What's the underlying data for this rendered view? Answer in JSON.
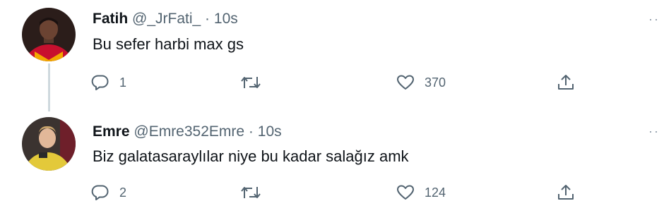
{
  "colors": {
    "text_primary": "#0f1419",
    "text_secondary": "#536471",
    "thread_line": "#cfd9de",
    "background": "#ffffff"
  },
  "tweets": [
    {
      "name": "Fatih",
      "handle": "@_JrFati_",
      "separator": "·",
      "time": "10s",
      "text": "Bu sefer harbi max gs",
      "more_icon": "more-horizontal-icon",
      "actions": {
        "reply_icon": "reply-icon",
        "reply_count": "1",
        "retweet_icon": "retweet-icon",
        "retweet_count": "",
        "like_icon": "heart-icon",
        "like_count": "370",
        "share_icon": "share-icon"
      }
    },
    {
      "name": "Emre",
      "handle": "@Emre352Emre",
      "separator": "·",
      "time": "10s",
      "text": "Biz galatasaraylılar niye bu kadar salağız amk",
      "more_icon": "more-horizontal-icon",
      "actions": {
        "reply_icon": "reply-icon",
        "reply_count": "2",
        "retweet_icon": "retweet-icon",
        "retweet_count": "",
        "like_icon": "heart-icon",
        "like_count": "124",
        "share_icon": "share-icon"
      }
    }
  ]
}
